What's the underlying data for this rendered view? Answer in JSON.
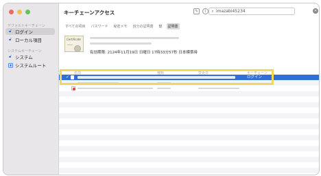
{
  "window": {
    "title": "キーチェーンアクセス",
    "traffic_lights": {
      "close": "#ee6a5e",
      "minimize": "#f5bf4f",
      "zoom": "#61c454"
    }
  },
  "sidebar": {
    "default_heading": "デフォルトキーチェーン",
    "default_items": [
      {
        "label": "ログイン",
        "icon": "unlock-icon",
        "selected": true
      },
      {
        "label": "ローカル項目",
        "icon": "unlock-icon",
        "selected": false
      }
    ],
    "system_heading": "システムキーチェーン",
    "system_items": [
      {
        "label": "システム",
        "icon": "unlock-icon",
        "selected": false
      },
      {
        "label": "システムルート",
        "icon": "keychain-icon",
        "selected": false
      }
    ]
  },
  "toolbar": {
    "edit_icon": "compose-icon",
    "info_icon": "info-icon",
    "search_value": "imazabi45234",
    "clear_icon": "clear-icon"
  },
  "tabs": [
    {
      "label": "すべての項目",
      "selected": false
    },
    {
      "label": "パスワード",
      "selected": false
    },
    {
      "label": "秘密メモ",
      "selected": false
    },
    {
      "label": "自分の証明書",
      "selected": false
    },
    {
      "label": "鍵",
      "selected": false
    },
    {
      "label": "証明書",
      "selected": true
    }
  ],
  "detail": {
    "certificate_label": "Certificate",
    "expiry": "有効期限: 2124年11月19日 日曜日 17時33分57秒 日本標準時"
  },
  "columns": {
    "name": "名前",
    "kind": "種類",
    "modified": "変更日",
    "expires": "有効期限",
    "keychain": "キーチェーン"
  },
  "selected_row": {
    "kind": "ログイン"
  },
  "accent_color": "#2f6fd8",
  "highlight_color": "#f2d75c"
}
